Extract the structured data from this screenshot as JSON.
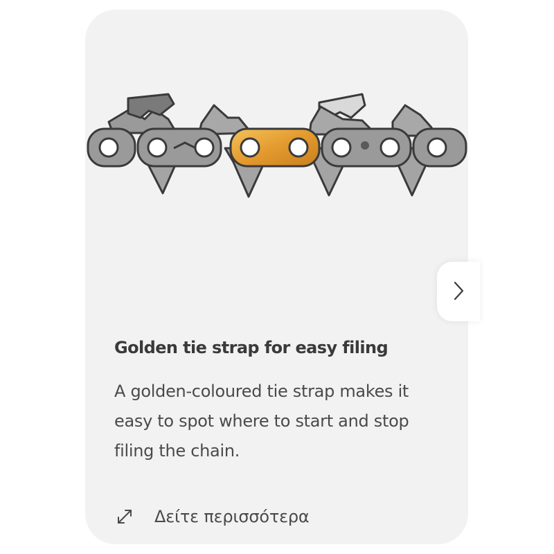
{
  "card": {
    "title": "Golden tie strap for easy filing",
    "description": "A golden-coloured tie strap makes it easy to spot where to start and stop filing the chain.",
    "link_label": "Δείτε περισσότερα",
    "link_icon": "expand-arrow-icon",
    "image_icon": "chainsaw-chain-illustration"
  },
  "carousel": {
    "next_icon": "chevron-right-icon"
  },
  "colors": {
    "card_background": "#f2f2f2",
    "chain_link": "#9a9a9a",
    "chain_outline": "#3a3a3a",
    "golden_strap": "#e8a33c",
    "text_primary": "#3a3a3a",
    "text_secondary": "#4a4a4a"
  }
}
